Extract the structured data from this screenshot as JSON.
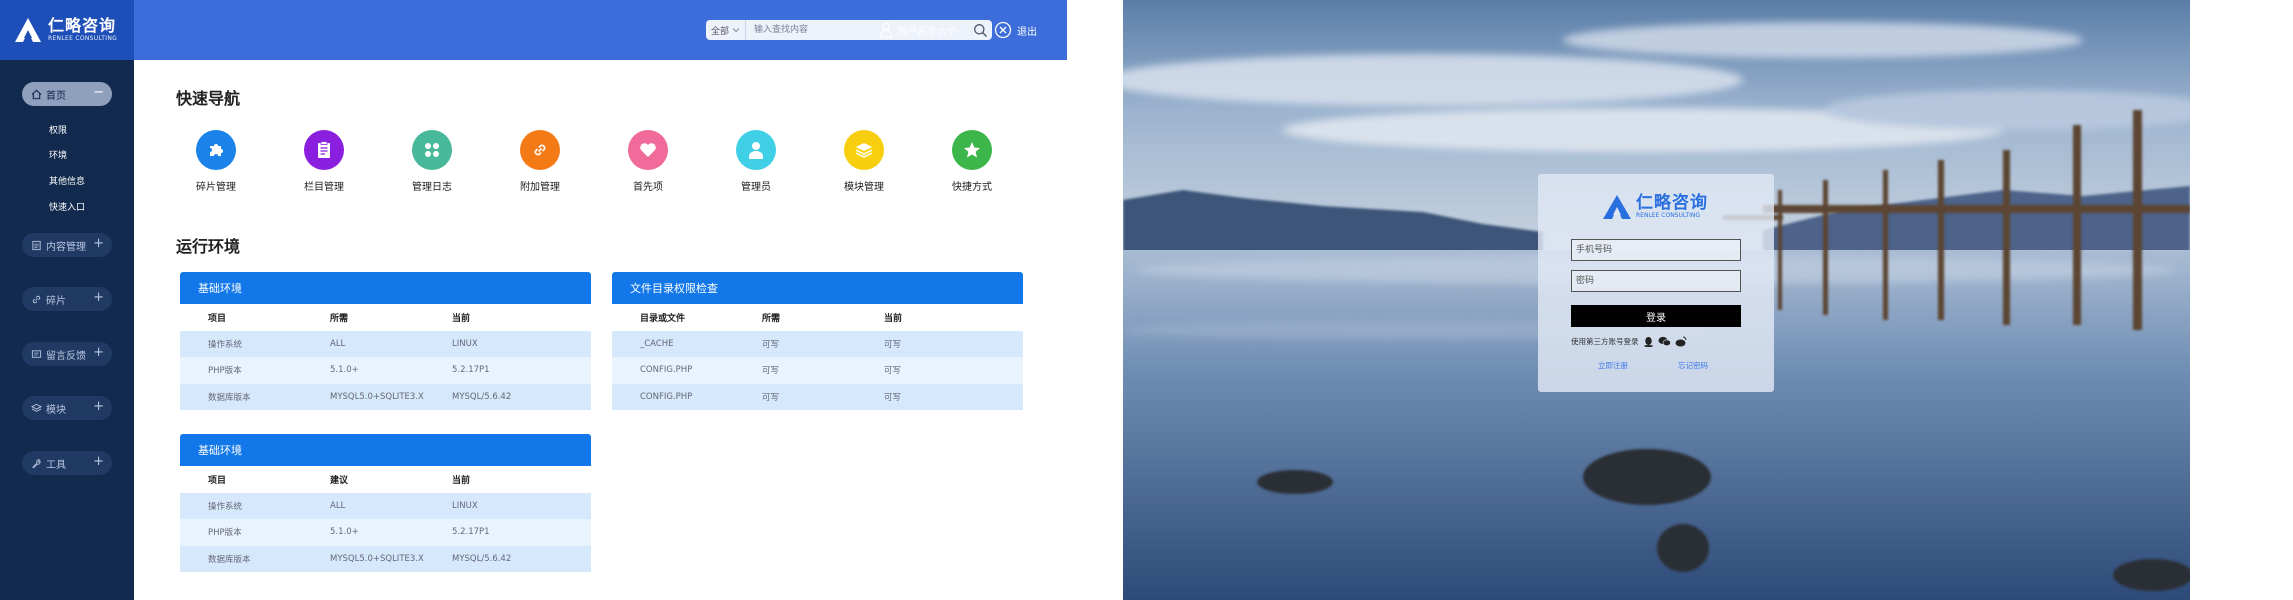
{
  "brand": {
    "name": "仁略咨询",
    "sub": "RENLEE CONSULTING",
    "color": "#2a6fe0"
  },
  "header": {
    "search_select": "全部",
    "search_placeholder": "输入查找内容",
    "user_name": "用户名字六个",
    "logout": "退出"
  },
  "sidebar": {
    "groups": [
      {
        "label": "首页",
        "toggle": "−",
        "active": true,
        "icon": "home-icon"
      },
      {
        "label": "内容管理",
        "toggle": "+",
        "icon": "document-icon"
      },
      {
        "label": "碎片",
        "toggle": "+",
        "icon": "link-icon"
      },
      {
        "label": "留言反馈",
        "toggle": "+",
        "icon": "message-icon"
      },
      {
        "label": "模块",
        "toggle": "+",
        "icon": "layers-icon"
      },
      {
        "label": "工具",
        "toggle": "+",
        "icon": "wrench-icon"
      }
    ],
    "sub_items": [
      "权限",
      "环境",
      "其他信息",
      "快速入口"
    ]
  },
  "quick_nav": {
    "title": "快速导航",
    "items": [
      {
        "label": "碎片管理",
        "color": "#1a82e8",
        "icon": "puzzle-icon"
      },
      {
        "label": "栏目管理",
        "color": "#8b1fe0",
        "icon": "clipboard-icon"
      },
      {
        "label": "管理日志",
        "color": "#47b89a",
        "icon": "grid-icon"
      },
      {
        "label": "附加管理",
        "color": "#f47a16",
        "icon": "link-icon"
      },
      {
        "label": "首先项",
        "color": "#f06b99",
        "icon": "heart-icon"
      },
      {
        "label": "管理员",
        "color": "#3fcfe6",
        "icon": "user-icon"
      },
      {
        "label": "模块管理",
        "color": "#f8cf0f",
        "icon": "stack-icon"
      },
      {
        "label": "快捷方式",
        "color": "#3cb54a",
        "icon": "star-icon"
      }
    ]
  },
  "env": {
    "title": "运行环境",
    "panels": [
      {
        "title": "基础环境",
        "headers": [
          "项目",
          "所需",
          "当前"
        ],
        "rows": [
          [
            "操作系统",
            "ALL",
            "LINUX"
          ],
          [
            "PHP版本",
            "5.1.0+",
            "5.2.17P1"
          ],
          [
            "数据库版本",
            "MYSQL5.0+SQLITE3.X",
            "MYSQL/5.6.42"
          ]
        ]
      },
      {
        "title": "文件目录权限检查",
        "headers": [
          "目录或文件",
          "所需",
          "当前"
        ],
        "rows": [
          [
            "_CACHE",
            "可写",
            "可写"
          ],
          [
            "CONFIG.PHP",
            "可写",
            "可写"
          ],
          [
            "CONFIG.PHP",
            "可写",
            "可写"
          ]
        ]
      },
      {
        "title": "基础环境",
        "headers": [
          "项目",
          "建议",
          "当前"
        ],
        "rows": [
          [
            "操作系统",
            "ALL",
            "LINUX"
          ],
          [
            "PHP版本",
            "5.1.0+",
            "5.2.17P1"
          ],
          [
            "数据库版本",
            "MYSQL5.0+SQLITE3.X",
            "MYSQL/5.6.42"
          ]
        ]
      }
    ]
  },
  "login": {
    "phone_placeholder": "手机号码",
    "password_placeholder": "密码",
    "submit": "登录",
    "third_party": "使用第三方账号登录",
    "third_icons": [
      "qq-icon",
      "wechat-icon",
      "weibo-icon"
    ],
    "register": "立即注册",
    "forgot": "忘记密码"
  },
  "colors": {
    "sidebar_bg": "#132a4f",
    "topbar_bg": "#3d6cdb",
    "panel_head": "#1277e9",
    "login_button": "#000000"
  }
}
